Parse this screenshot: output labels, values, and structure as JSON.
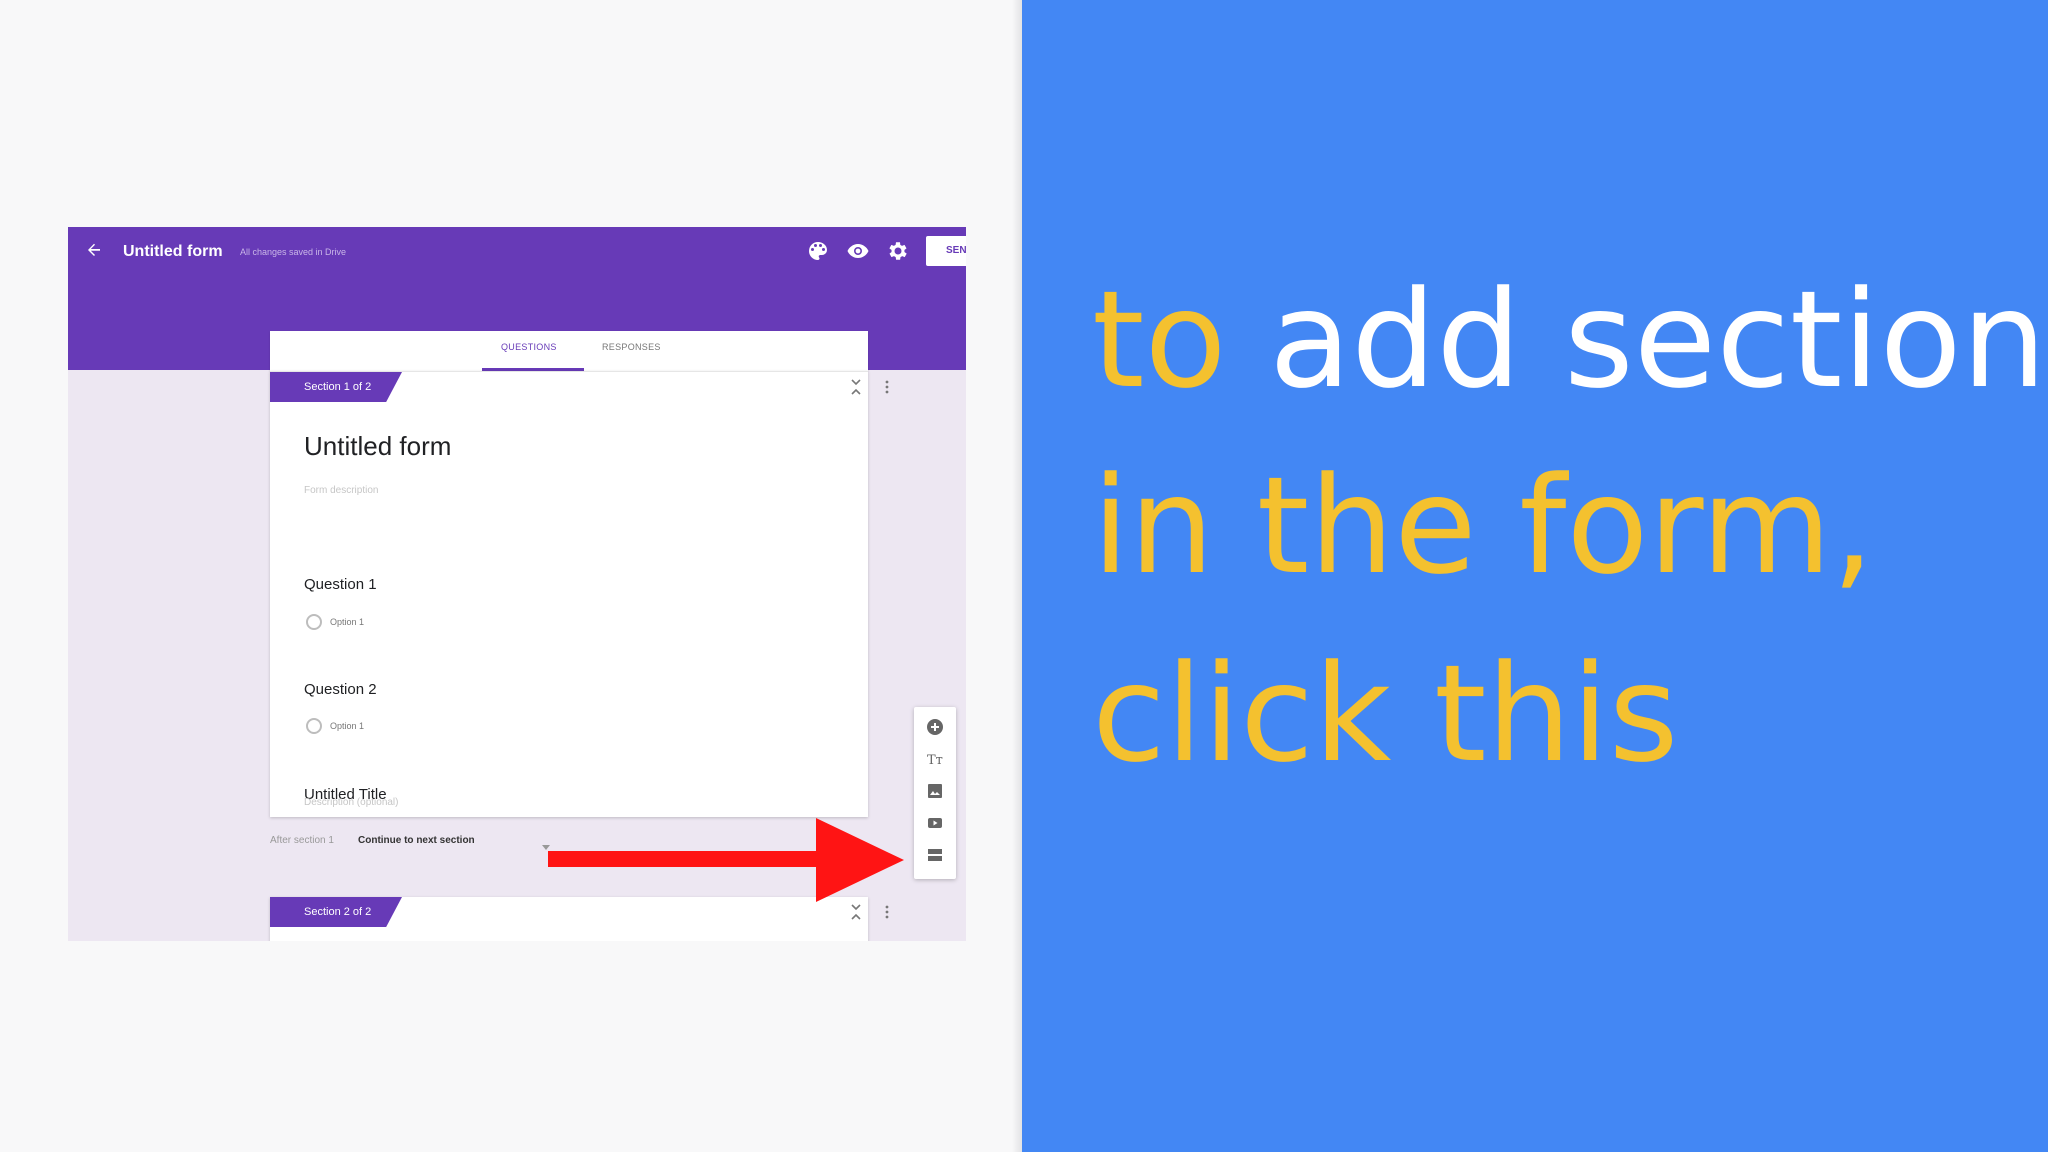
{
  "colors": {
    "accent_purple": "#673ab7",
    "panel_blue": "#4387f4",
    "caption_yellow": "#f4c12f",
    "caption_white": "#ffffff",
    "arrow_red": "#ff1414"
  },
  "forms_header": {
    "title": "Untitled form",
    "save_status": "All changes saved in Drive",
    "send_label": "SEN",
    "icons": [
      "back-arrow-icon",
      "palette-icon",
      "eye-icon",
      "gear-icon"
    ]
  },
  "tabs": {
    "questions": "QUESTIONS",
    "responses": "RESPONSES"
  },
  "section1": {
    "label": "Section 1 of 2",
    "title": "Untitled form",
    "description": "Form description",
    "questions": [
      {
        "title": "Question 1",
        "option": "Option 1"
      },
      {
        "title": "Question 2",
        "option": "Option 1"
      }
    ],
    "title_block": {
      "title": "Untitled Title",
      "description": "Description (optional)"
    }
  },
  "after_section": {
    "label": "After section 1",
    "value": "Continue to next section"
  },
  "section2": {
    "label": "Section 2 of 2"
  },
  "toolbar_icons": [
    "add-question-icon",
    "add-title-icon",
    "add-image-icon",
    "add-video-icon",
    "add-section-icon"
  ],
  "caption": {
    "line1_a": "to",
    "line1_b": " add section",
    "line2": "in the form,",
    "line3": "click this"
  }
}
